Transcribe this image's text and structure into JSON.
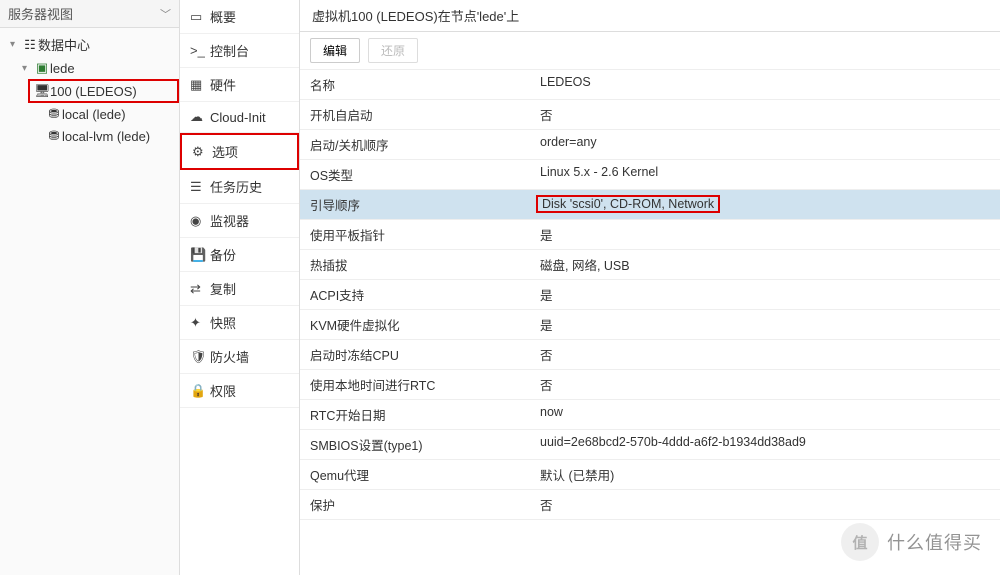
{
  "tree": {
    "header": "服务器视图",
    "root": {
      "label": "数据中心"
    },
    "node": {
      "label": "lede"
    },
    "vm": {
      "label": "100 (LEDEOS)"
    },
    "storages": [
      {
        "label": "local (lede)"
      },
      {
        "label": "local-lvm (lede)"
      }
    ]
  },
  "nav": {
    "items": [
      {
        "icon": "book",
        "label": "概要"
      },
      {
        "icon": "terminal",
        "label": "控制台"
      },
      {
        "icon": "chip",
        "label": "硬件"
      },
      {
        "icon": "cloud",
        "label": "Cloud-Init"
      },
      {
        "icon": "gear",
        "label": "选项"
      },
      {
        "icon": "list",
        "label": "任务历史"
      },
      {
        "icon": "eye",
        "label": "监视器"
      },
      {
        "icon": "save",
        "label": "备份"
      },
      {
        "icon": "copy",
        "label": "复制"
      },
      {
        "icon": "magic",
        "label": "快照"
      },
      {
        "icon": "shield",
        "label": "防火墙"
      },
      {
        "icon": "lock",
        "label": "权限"
      }
    ]
  },
  "content": {
    "title": "虚拟机100 (LEDEOS)在节点'lede'上",
    "buttons": {
      "edit": "编辑",
      "revert": "还原"
    },
    "rows": [
      {
        "k": "名称",
        "v": "LEDEOS"
      },
      {
        "k": "开机自启动",
        "v": "否"
      },
      {
        "k": "启动/关机顺序",
        "v": "order=any"
      },
      {
        "k": "OS类型",
        "v": "Linux 5.x - 2.6 Kernel"
      },
      {
        "k": "引导顺序",
        "v": "Disk 'scsi0', CD-ROM, Network",
        "highlighted": true
      },
      {
        "k": "使用平板指针",
        "v": "是"
      },
      {
        "k": "热插拔",
        "v": "磁盘, 网络, USB"
      },
      {
        "k": "ACPI支持",
        "v": "是"
      },
      {
        "k": "KVM硬件虚拟化",
        "v": "是"
      },
      {
        "k": "启动时冻结CPU",
        "v": "否"
      },
      {
        "k": "使用本地时间进行RTC",
        "v": "否"
      },
      {
        "k": "RTC开始日期",
        "v": "now"
      },
      {
        "k": "SMBIOS设置(type1)",
        "v": "uuid=2e68bcd2-570b-4ddd-a6f2-b1934dd38ad9"
      },
      {
        "k": "Qemu代理",
        "v": "默认 (已禁用)"
      },
      {
        "k": "保护",
        "v": "否"
      }
    ]
  },
  "watermark": {
    "badge": "值",
    "text": "什么值得买"
  }
}
